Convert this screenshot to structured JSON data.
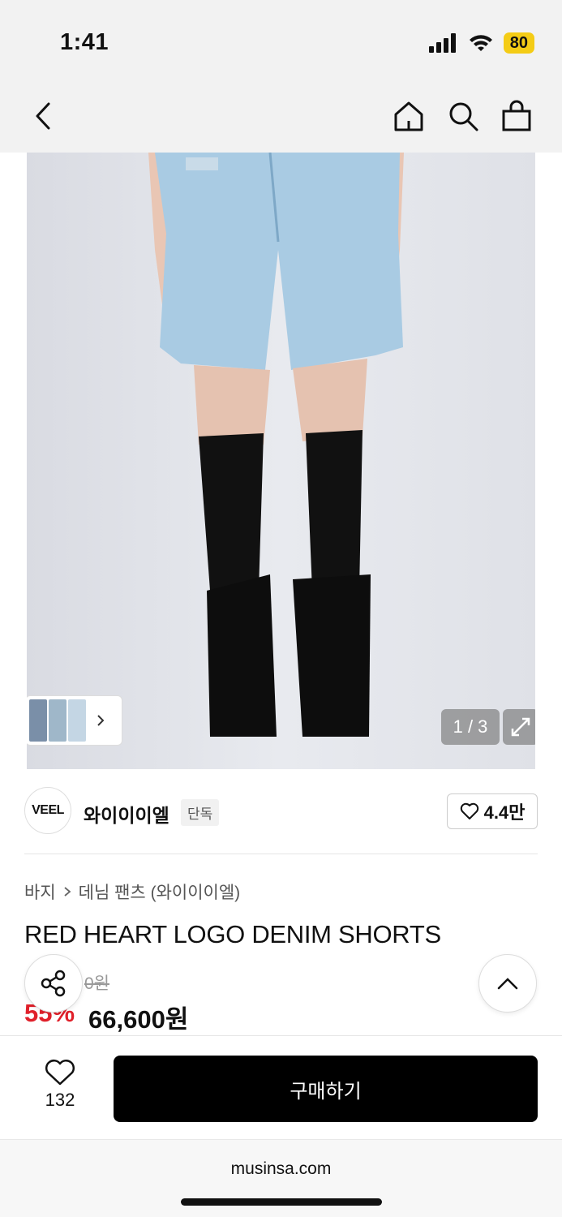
{
  "status": {
    "time": "1:41",
    "battery": "80"
  },
  "gallery": {
    "counter": "1 / 3"
  },
  "brand": {
    "logo_text": "VEEL",
    "name": "와이이이엘",
    "badge": "단독",
    "likes": "4.4만"
  },
  "product": {
    "breadcrumb": [
      "바지",
      "데님 팬츠 (와이이이엘)"
    ],
    "title": "RED HEART LOGO DENIM SHORTS",
    "original_price": "0원",
    "discount": "55%",
    "price": "66,600원"
  },
  "actions": {
    "wish_count": "132",
    "buy_label": "구매하기"
  },
  "browser": {
    "url": "musinsa.com"
  },
  "colors": {
    "discount": "#e0202a",
    "buy_button": "#000000",
    "battery": "#f4cc16"
  }
}
